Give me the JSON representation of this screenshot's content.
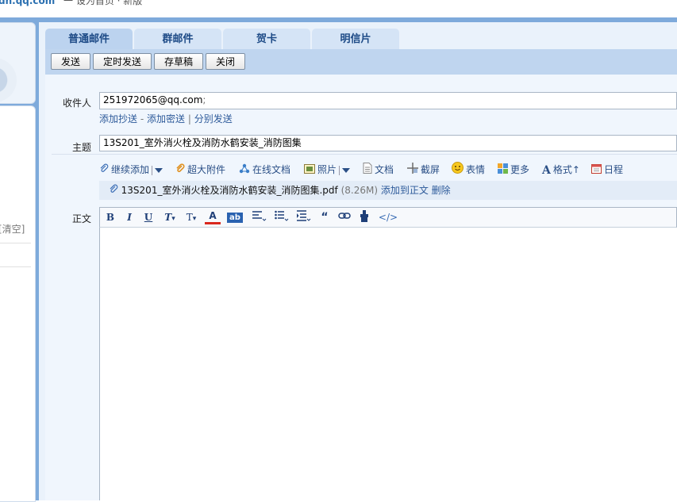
{
  "topbar": {
    "site_fragment": "dn.qq.com",
    "tail_fragment": "一 设为首页 · 新版"
  },
  "left": {
    "clear_link": "[清空]"
  },
  "tabs": [
    {
      "label": "普通邮件",
      "active": true
    },
    {
      "label": "群邮件",
      "active": false
    },
    {
      "label": "贺卡",
      "active": false
    },
    {
      "label": "明信片",
      "active": false
    }
  ],
  "toolbar": {
    "send": "发送",
    "timed_send": "定时发送",
    "save_draft": "存草稿",
    "close": "关闭"
  },
  "form": {
    "to_label": "收件人",
    "to_value": "251972065@qq.com",
    "to_sep": ";",
    "cc_link": "添加抄送",
    "bcc_link": "添加密送",
    "separate_link": "分别发送",
    "subject_label": "主题",
    "subject_value": "13S201_室外消火栓及消防水鹤安装_消防图集",
    "body_label": "正文"
  },
  "attach_bar": {
    "continue_add": "继续添加",
    "big_attach": "超大附件",
    "online_doc": "在线文档",
    "photo": "照片",
    "doc": "文档",
    "screenshot": "截屏",
    "emoji": "表情",
    "more": "更多",
    "format": "格式",
    "format_arrow": "↑",
    "calendar": "日程"
  },
  "attachment": {
    "filename": "13S201_室外消火栓及消防水鹤安装_消防图集.pdf",
    "size": "(8.26M)",
    "add_to_body": "添加到正文",
    "delete": "删除"
  },
  "editor_toolbar": {
    "bold": "B",
    "italic": "I",
    "underline": "U",
    "clear_format": "T",
    "font_size": "T",
    "font_color": "A",
    "bg_color": "ab",
    "quote": "“",
    "code": "</>"
  },
  "colors": {
    "accent": "#7eaadb",
    "link": "#2d5a9a",
    "tab_text": "#1d4a86",
    "toolbar_bg": "#bfd5ef"
  }
}
